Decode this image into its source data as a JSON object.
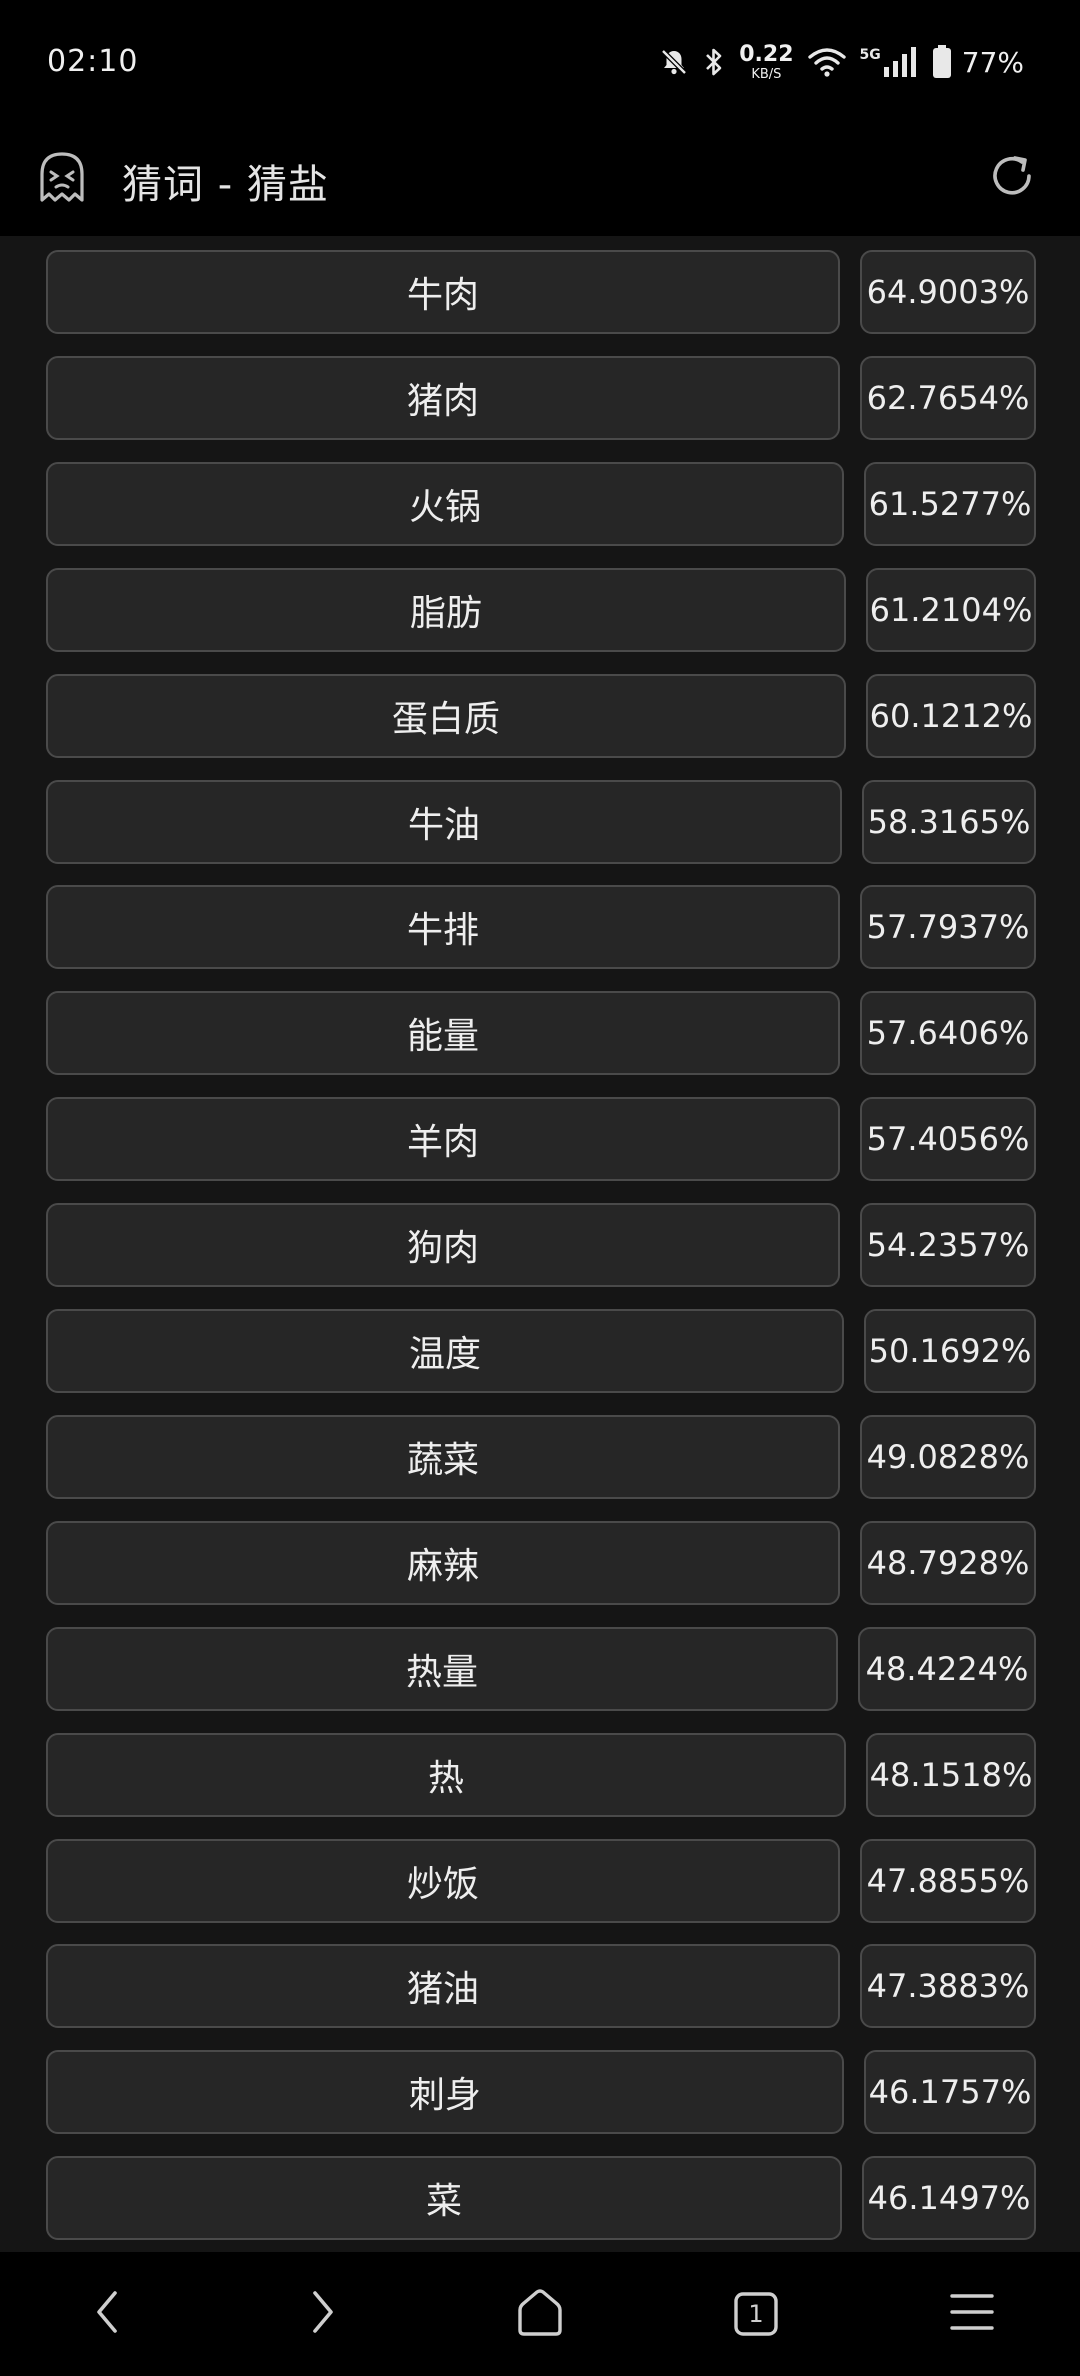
{
  "status_bar": {
    "time": "02:10",
    "net_speed": "0.22",
    "net_unit": "KB/S",
    "network_type": "5G",
    "battery": "77%"
  },
  "app_bar": {
    "title": "猜词 - 猜盐",
    "icon": "ghost-icon",
    "refresh_icon": "refresh-icon"
  },
  "rows": [
    {
      "word": "牛肉",
      "pct": "64.9003%"
    },
    {
      "word": "猪肉",
      "pct": "62.7654%"
    },
    {
      "word": "火锅",
      "pct": "61.5277%"
    },
    {
      "word": "脂肪",
      "pct": "61.2104%"
    },
    {
      "word": "蛋白质",
      "pct": "60.1212%"
    },
    {
      "word": "牛油",
      "pct": "58.3165%"
    },
    {
      "word": "牛排",
      "pct": "57.7937%"
    },
    {
      "word": "能量",
      "pct": "57.6406%"
    },
    {
      "word": "羊肉",
      "pct": "57.4056%"
    },
    {
      "word": "狗肉",
      "pct": "54.2357%"
    },
    {
      "word": "温度",
      "pct": "50.1692%"
    },
    {
      "word": "蔬菜",
      "pct": "49.0828%"
    },
    {
      "word": "麻辣",
      "pct": "48.7928%"
    },
    {
      "word": "热量",
      "pct": "48.4224%"
    },
    {
      "word": "热",
      "pct": "48.1518%"
    },
    {
      "word": "炒饭",
      "pct": "47.8855%"
    },
    {
      "word": "猪油",
      "pct": "47.3883%"
    },
    {
      "word": "刺身",
      "pct": "46.1757%"
    },
    {
      "word": "菜",
      "pct": "46.1497%"
    }
  ],
  "nav_bar": {
    "tab_count": "1",
    "icons": [
      "chevron-left-icon",
      "chevron-right-icon",
      "home-icon",
      "tabs-icon",
      "menu-icon"
    ]
  },
  "colors": {
    "background": "#151515",
    "bar_background": "#000000",
    "cell_fill": "#262626",
    "cell_border": "#4a4a4a",
    "text": "#eeeeee"
  }
}
